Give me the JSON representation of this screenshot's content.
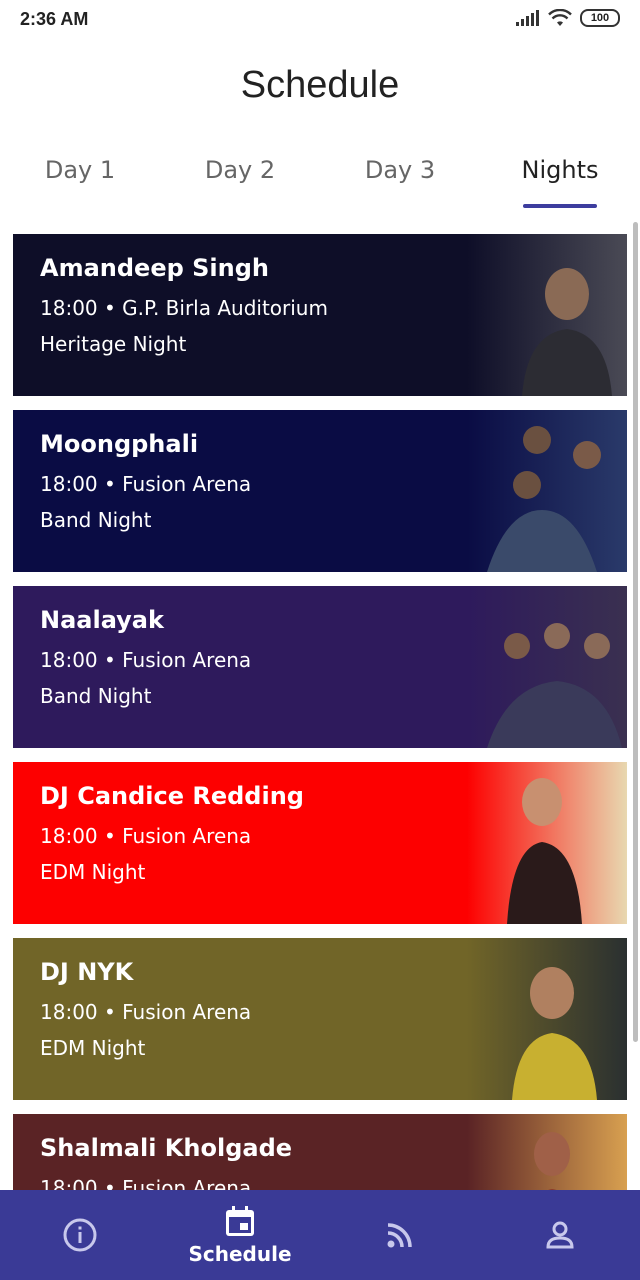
{
  "status": {
    "time": "2:36 AM",
    "battery": "100"
  },
  "header": {
    "title": "Schedule"
  },
  "tabs": [
    {
      "label": "Day 1",
      "active": false
    },
    {
      "label": "Day 2",
      "active": false
    },
    {
      "label": "Day 3",
      "active": false
    },
    {
      "label": "Nights",
      "active": true
    }
  ],
  "events": [
    {
      "name": "Amandeep Singh",
      "meta": "18:00 • G.P. Birla Auditorium",
      "type": "Heritage Night",
      "color": "#0e0e28"
    },
    {
      "name": "Moongphali",
      "meta": "18:00 • Fusion Arena",
      "type": "Band Night",
      "color": "#0a0c44"
    },
    {
      "name": "Naalayak",
      "meta": "18:00 • Fusion Arena",
      "type": "Band Night",
      "color": "#2e1a5c"
    },
    {
      "name": "DJ Candice Redding",
      "meta": "18:00 • Fusion Arena",
      "type": "EDM Night",
      "color": "#fd0000"
    },
    {
      "name": "DJ NYK",
      "meta": "18:00 • Fusion Arena",
      "type": "EDM Night",
      "color": "#716528"
    },
    {
      "name": "Shalmali Kholgade",
      "meta": "18:00 • Fusion Arena",
      "type": "",
      "color": "#5a2325"
    }
  ],
  "nav": {
    "items": [
      {
        "name": "info",
        "label": "",
        "icon": "info-icon"
      },
      {
        "name": "schedule",
        "label": "Schedule",
        "icon": "calendar-icon"
      },
      {
        "name": "feed",
        "label": "",
        "icon": "rss-icon"
      },
      {
        "name": "profile",
        "label": "",
        "icon": "person-icon"
      }
    ]
  }
}
